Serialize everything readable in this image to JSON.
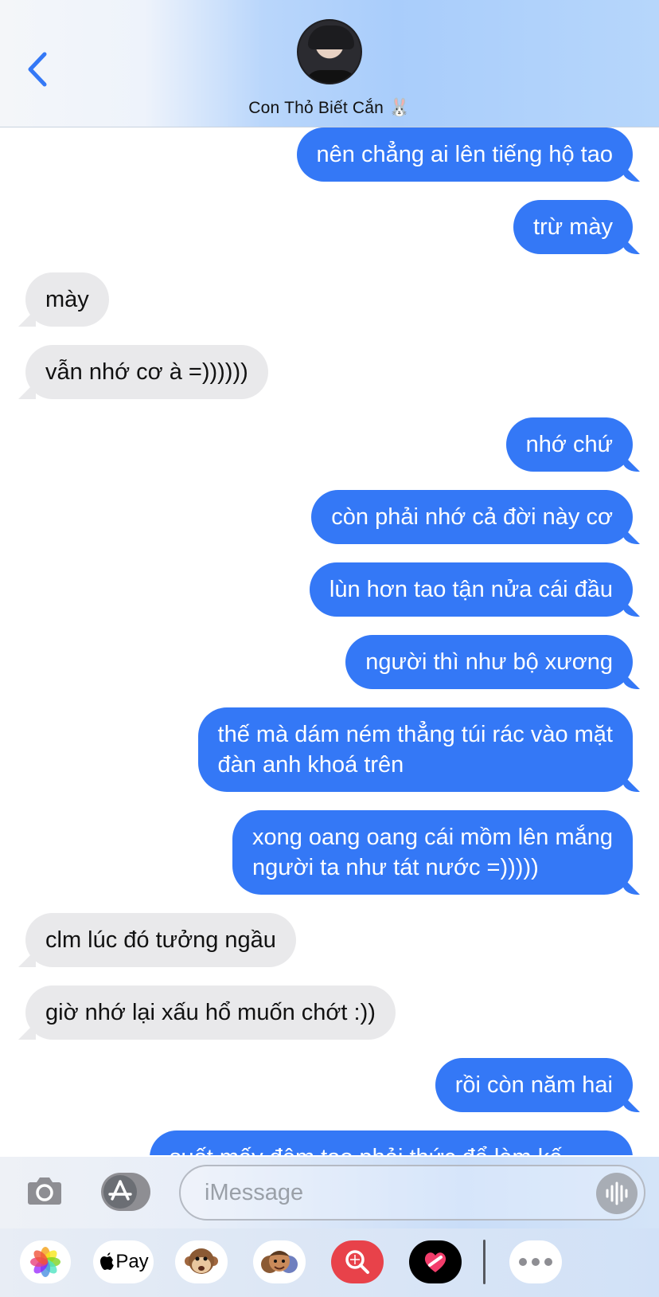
{
  "header": {
    "contact_name": "Con Thỏ Biết Cắn",
    "contact_emoji": "🐰"
  },
  "messages": [
    {
      "dir": "out",
      "text": "nên chẳng ai lên tiếng hộ tao"
    },
    {
      "dir": "out",
      "text": "trừ mày"
    },
    {
      "dir": "in",
      "text": "mày"
    },
    {
      "dir": "in",
      "text": "vẫn nhớ cơ à =))))))"
    },
    {
      "dir": "out",
      "text": "nhớ chứ"
    },
    {
      "dir": "out",
      "text": "còn phải nhớ cả đời này cơ"
    },
    {
      "dir": "out",
      "text": "lùn hơn tao tận nửa cái đầu"
    },
    {
      "dir": "out",
      "text": "người thì như bộ xương"
    },
    {
      "dir": "out",
      "lines": [
        "thế mà dám ném thẳng túi rác vào mặt",
        "đàn anh khoá trên"
      ]
    },
    {
      "dir": "out",
      "lines": [
        "xong oang oang cái mồm lên mắng",
        "người ta như tát nước =)))))"
      ]
    },
    {
      "dir": "in",
      "text": "clm lúc đó tưởng ngầu"
    },
    {
      "dir": "in",
      "text": "giờ nhớ lại xấu hổ muốn chớt :))"
    },
    {
      "dir": "out",
      "text": "rồi còn năm hai"
    },
    {
      "dir": "out",
      "text": "suốt mấy đêm tao phải thức để làm kế"
    }
  ],
  "input": {
    "placeholder": "iMessage"
  },
  "apps": {
    "apple_pay_label": "Pay"
  },
  "colors": {
    "outgoing_bubble": "#3478f6",
    "incoming_bubble": "#e9e9eb",
    "accent": "#3478f6"
  }
}
